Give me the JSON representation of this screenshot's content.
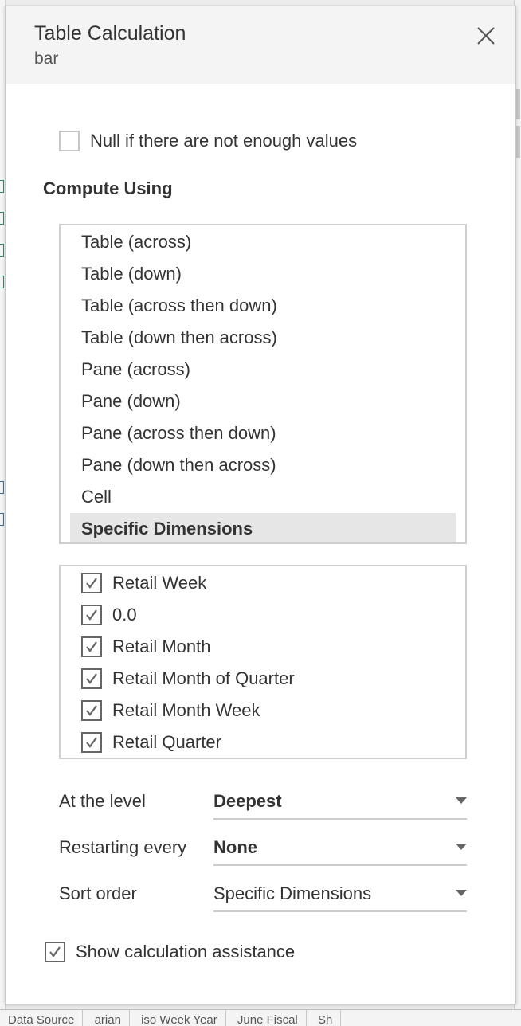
{
  "dialog": {
    "title": "Table Calculation",
    "subtitle": "bar",
    "close_icon": "close-icon"
  },
  "null_option": {
    "label": "Null if there are not enough values",
    "checked": false
  },
  "compute_using": {
    "title": "Compute Using",
    "items": [
      {
        "label": "Table (across)",
        "selected": false
      },
      {
        "label": "Table (down)",
        "selected": false
      },
      {
        "label": "Table (across then down)",
        "selected": false
      },
      {
        "label": "Table (down then across)",
        "selected": false
      },
      {
        "label": "Pane (across)",
        "selected": false
      },
      {
        "label": "Pane (down)",
        "selected": false
      },
      {
        "label": "Pane (across then down)",
        "selected": false
      },
      {
        "label": "Pane (down then across)",
        "selected": false
      },
      {
        "label": "Cell",
        "selected": false
      },
      {
        "label": "Specific Dimensions",
        "selected": true
      }
    ]
  },
  "dimensions": {
    "items": [
      {
        "label": "Retail Week",
        "checked": true
      },
      {
        "label": "0.0",
        "checked": true
      },
      {
        "label": "Retail Month",
        "checked": true
      },
      {
        "label": "Retail Month of Quarter",
        "checked": true
      },
      {
        "label": "Retail Month Week",
        "checked": true
      },
      {
        "label": "Retail Quarter",
        "checked": true
      }
    ]
  },
  "fields": {
    "at_the_level": {
      "label": "At the level",
      "value": "Deepest"
    },
    "restarting_every": {
      "label": "Restarting every",
      "value": "None"
    },
    "sort_order": {
      "label": "Sort order",
      "value": "Specific Dimensions"
    }
  },
  "calc_assistance": {
    "label": "Show calculation assistance",
    "checked": true
  },
  "background": {
    "bottom_tabs": [
      "Data Source",
      "arian",
      "iso Week Year",
      "June Fiscal",
      "Sh"
    ]
  },
  "colors": {
    "header_bg": "#f4f4f4",
    "selected_bg": "#e6e6e6",
    "border": "#cfcfcf",
    "text": "#333333"
  }
}
